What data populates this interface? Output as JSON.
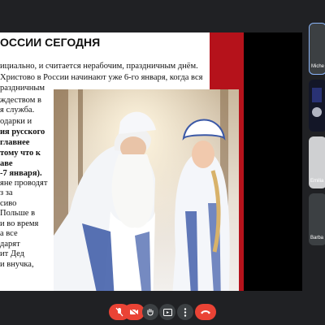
{
  "slide": {
    "title": "ОССИИ СЕГОДНЯ",
    "lines": [
      {
        "text": "ициально, и считается нерабочим, праздничным днём.",
        "bold": false
      },
      {
        "text": "Христово в России начинают уже 6-го января, когда вся",
        "bold": false
      },
      {
        "text": "раздничным",
        "bold": false
      },
      {
        "text": "ждеством в",
        "bold": false
      },
      {
        "text": "я служба.",
        "bold": false
      },
      {
        "text": "одарки и",
        "bold": false
      },
      {
        "text": "ия русского",
        "bold": true
      },
      {
        "text": "главнее",
        "bold": true
      },
      {
        "text": "тому что к",
        "bold": true
      },
      {
        "text": "аве",
        "bold": true
      },
      {
        "text": "-7 января).",
        "bold": true
      },
      {
        "text": "яне проводят",
        "bold": false
      },
      {
        "text": "з за",
        "bold": false
      },
      {
        "text": "сиво",
        "bold": false
      },
      {
        "text": "Польше в",
        "bold": false
      },
      {
        "text": "и во время",
        "bold": false
      },
      {
        "text": "а все",
        "bold": false
      },
      {
        "text": "дарят",
        "bold": false
      },
      {
        "text": "ит Дед",
        "bold": false
      },
      {
        "text": "и внучка,",
        "bold": false
      }
    ]
  },
  "participants": [
    {
      "name": "Miche"
    },
    {
      "name": ""
    },
    {
      "name": "Emilia"
    },
    {
      "name": "Barba"
    }
  ],
  "colors": {
    "background": "#202124",
    "slide_red": "#b5121b",
    "hangup": "#ea4335"
  },
  "toolbar": {
    "icons": [
      "mic-off-icon",
      "camera-off-icon",
      "raise-hand-icon",
      "present-icon",
      "more-options-icon",
      "hang-up-icon"
    ]
  }
}
